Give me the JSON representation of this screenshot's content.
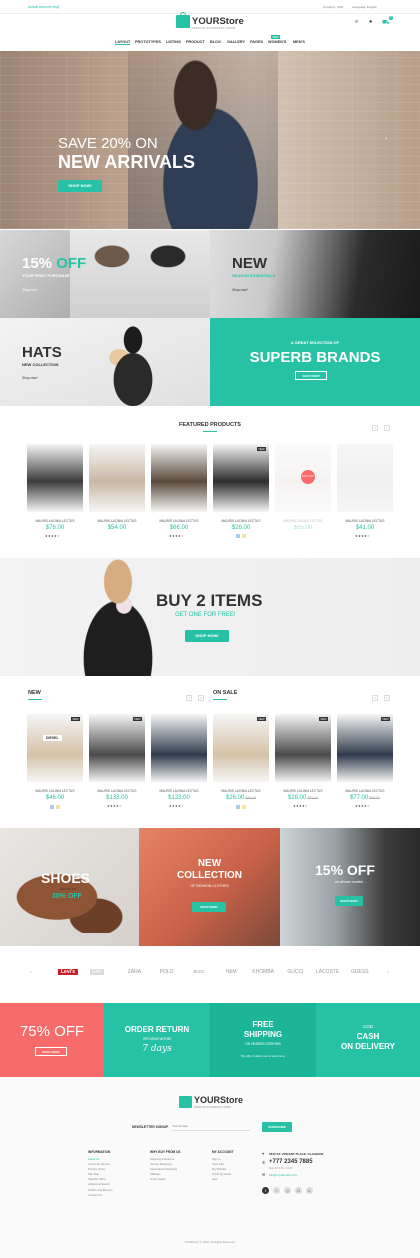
{
  "topbar": {
    "note": "Default welcome msg!",
    "currency": "Currency: USD",
    "language": "Language: English"
  },
  "header": {
    "logo_text": "YOURStore",
    "tagline": "PREMIUM ECOMMERCE THEME",
    "cart_count": "0"
  },
  "nav": {
    "items": [
      "LAYOUT",
      "PROTOTYPES",
      "LISTING",
      "PRODUCT",
      "BLOG",
      "GALLERY",
      "PAGES",
      "WOMEN'S",
      "MEN'S"
    ],
    "new_badge": "NEW"
  },
  "hero": {
    "line1": "SAVE 20% ON",
    "line2": "NEW ARRIVALS",
    "button": "SHOP NOW!"
  },
  "banners": {
    "b1": {
      "title": "15% OFF",
      "subtitle": "YOUR FIRST PURCHASE",
      "link": "Shop now!"
    },
    "b2": {
      "title": "NEW",
      "subtitle": "SEASON ESSENTIALS",
      "link": "Shop now!"
    },
    "b3": {
      "title": "HATS",
      "subtitle": "NEW COLLECTION",
      "link": "Shop now!"
    },
    "b4": {
      "kicker": "A GREAT SELECTION OF",
      "title": "SUPERB BRANDS",
      "button": "SHOP NOW!"
    }
  },
  "featured": {
    "title": "FEATURED PRODUCTS",
    "products": [
      {
        "name": "MAURIS LACINIA LECTUS",
        "price": "$76.00",
        "stars": "★★★★☆"
      },
      {
        "name": "MAURIS LACINIA LECTUS",
        "price": "$54.00",
        "stars": ""
      },
      {
        "name": "MAURIS LACINIA LECTUS",
        "price": "$66.00",
        "stars": "★★★★☆"
      },
      {
        "name": "MAURIS LACINIA LECTUS",
        "price": "$26.00",
        "stars": "",
        "badge": "NEW"
      },
      {
        "name": "MAURIS LACINIA LECTUS",
        "price": "$35.00",
        "stars": "",
        "faded": true,
        "sold_out": "SOLD OUT"
      },
      {
        "name": "MAURIS LACINIA LECTUS",
        "price": "$41.00",
        "stars": "★★★★☆"
      }
    ]
  },
  "promo": {
    "title": "BUY 2 ITEMS",
    "subtitle": "GET ONE FOR FREE!",
    "button": "SHOP NOW!"
  },
  "new_section": {
    "title": "NEW",
    "products": [
      {
        "name": "MAURIS LACINIA LECTUS",
        "price": "$46.00",
        "old": "",
        "stars": "",
        "badge": "NEW",
        "label": "DIESEL"
      },
      {
        "name": "MAURIS LACINIA LECTUS",
        "price": "$133.00",
        "old": "",
        "stars": "★★★★☆",
        "badge": "NEW"
      },
      {
        "name": "MAURIS LACINIA LECTUS",
        "price": "$133.00",
        "old": "",
        "stars": "★★★★☆",
        "badge": ""
      }
    ]
  },
  "sale_section": {
    "title": "ON SALE",
    "products": [
      {
        "name": "MAURIS LACINIA LECTUS",
        "price": "$26.00",
        "old": "$49.00",
        "stars": "",
        "badge": "NEW"
      },
      {
        "name": "MAURIS LACINIA LECTUS",
        "price": "$26.00",
        "old": "$39.00",
        "stars": "★★★★☆",
        "badge": "NEW"
      },
      {
        "name": "MAURIS LACINIA LECTUS",
        "price": "$77.00",
        "old": "$89.00",
        "stars": "★★★★☆",
        "badge": "NEW"
      }
    ]
  },
  "collections": {
    "c1": {
      "title": "SHOES",
      "sub": "GET UP TO",
      "pct": "30% OFF"
    },
    "c2": {
      "title_l1": "NEW",
      "title_l2": "COLLECTION",
      "sub": "OF FASHION CLOTHES",
      "button": "SHOP NOW!"
    },
    "c3": {
      "title": "15% OFF",
      "sub": "on all new models",
      "button": "SHOP NOW!"
    }
  },
  "brands": [
    "Levi's",
    "GAP",
    "ZARA",
    "POLO",
    "ecco",
    "H&M",
    "KHOMBA",
    "GUCCI",
    "LACOSTE",
    "GUESS"
  ],
  "features": {
    "f1": {
      "title": "75% OFF",
      "button": "SHOP NOW!"
    },
    "f2": {
      "l1": "ORDER RETURN",
      "l2": "RETURNS WITHIN",
      "l3": "7 days"
    },
    "f3": {
      "l1": "FREE",
      "l2": "SHIPPING",
      "l3": "ON ORDERS OVER $99",
      "l4": "This offer is valid on all our store items."
    },
    "f4": {
      "l1": "COD",
      "l2": "CASH",
      "l3": "ON DELIVERY"
    }
  },
  "footer": {
    "logo_text": "YOURStore",
    "tagline": "PREMIUM ECOMMERCE THEME",
    "newsletter_label": "NEWSLETTER SIGNUP",
    "newsletter_placeholder": "Your E-mail",
    "subscribe": "SUBSCRIBE",
    "info_title": "INFORMATION",
    "info_links": [
      "About Us",
      "Customer Service",
      "Privacy Policy",
      "Site Map",
      "Specific Offers",
      "Advanced Search",
      "Orders and Returns",
      "Contact Us"
    ],
    "why_title": "WHY BUY FROM US",
    "why_links": [
      "Shipping & Returns",
      "Secure Shopping",
      "International Shipping",
      "Affiliates",
      "Group Sales"
    ],
    "account_title": "MY ACCOUNT",
    "account_links": [
      "Sign In",
      "View Cart",
      "My Wishlist",
      "Track My Order",
      "Help"
    ],
    "address": "7840 ST. VINCENT PLACE, GLASGOW",
    "phone": "+777 2345 7885",
    "hours": "Mon-Fri 9:00 - 19:00",
    "email": "info@mydomain.com",
    "copyright": "YOURStore © 2016. All Rights Reserved."
  },
  "colors": {
    "accent": "#27c2a5",
    "sale": "#f76b6a",
    "dark": "#333333"
  }
}
